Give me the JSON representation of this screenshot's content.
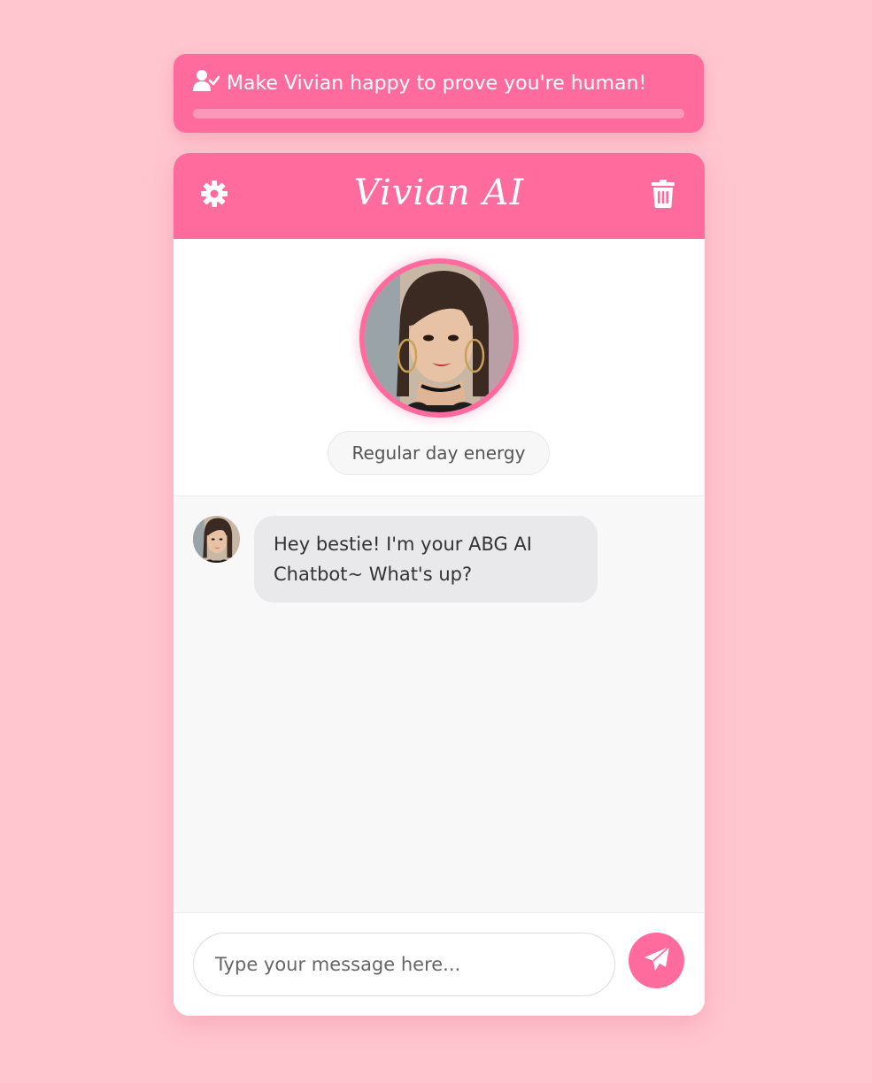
{
  "banner": {
    "icon": "user-check-icon",
    "text": "Make Vivian happy to prove you're human!",
    "progress": 0
  },
  "header": {
    "title": "Vivian AI",
    "settings_icon": "gear-icon",
    "clear_icon": "trash-icon"
  },
  "profile": {
    "avatar": "vivian-avatar",
    "mood": "Regular day energy"
  },
  "messages": [
    {
      "sender": "bot",
      "avatar": "vivian-avatar",
      "text": "Hey bestie! I'm your ABG AI Chatbot~ What's up?"
    }
  ],
  "composer": {
    "placeholder": "Type your message here...",
    "value": "",
    "send_icon": "paper-plane-icon"
  },
  "colors": {
    "background": "#ffc6cf",
    "accent": "#ff6b9d",
    "bubble_bot": "#e9e9eb",
    "messages_bg": "#f8f8f8"
  }
}
